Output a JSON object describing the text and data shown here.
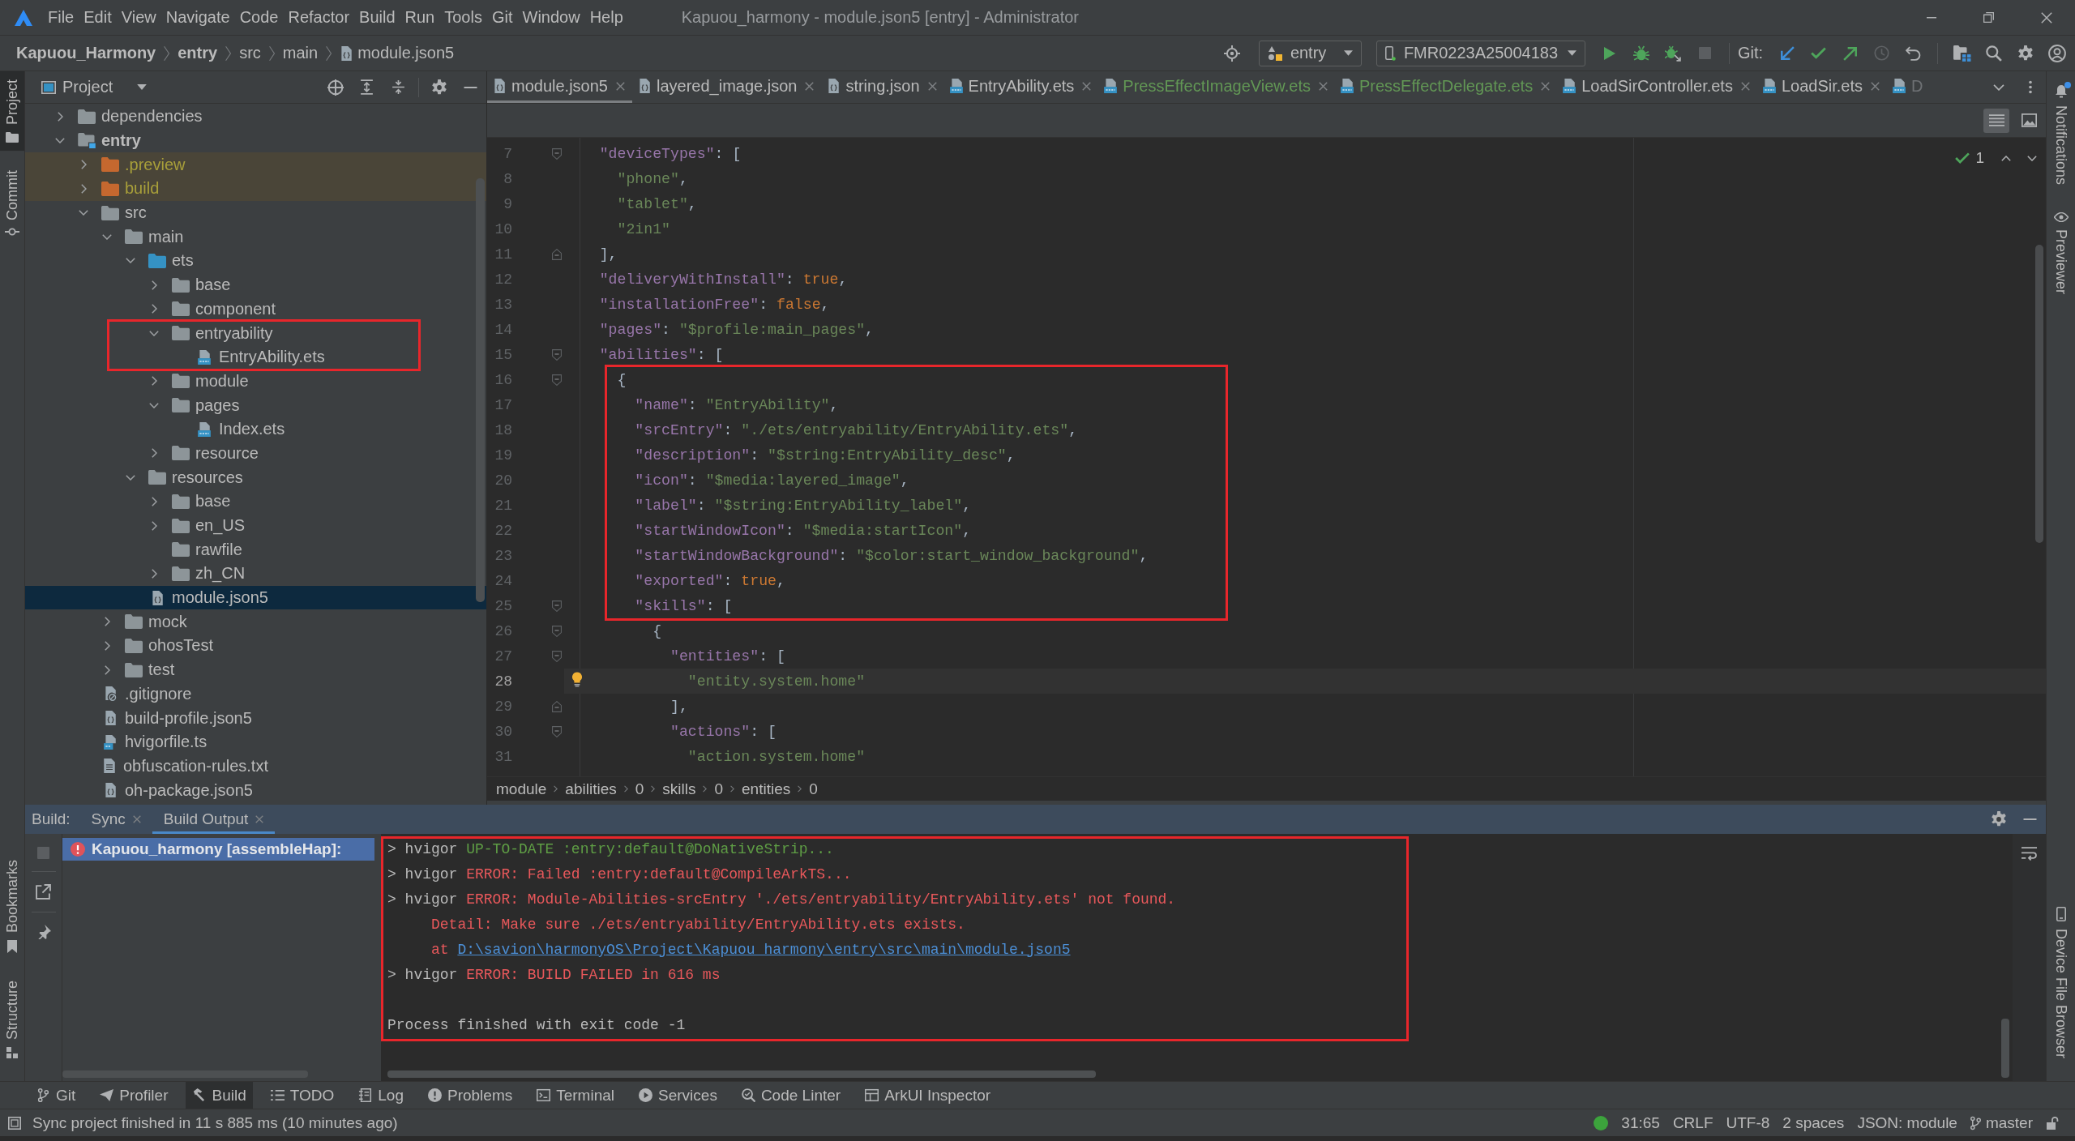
{
  "title_bar": {
    "menu": [
      "File",
      "Edit",
      "View",
      "Navigate",
      "Code",
      "Refactor",
      "Build",
      "Run",
      "Tools",
      "Git",
      "Window",
      "Help"
    ],
    "title": "Kapuou_harmony - module.json5 [entry] - Administrator"
  },
  "navigation_bar": {
    "breadcrumbs": [
      {
        "label": "Kapuou_Harmony",
        "kind": "project"
      },
      {
        "label": "entry",
        "kind": "module"
      },
      {
        "label": "src",
        "kind": "folder"
      },
      {
        "label": "main",
        "kind": "folder"
      },
      {
        "label": "module.json5",
        "kind": "json_file"
      }
    ],
    "run_configuration": "entry",
    "device": "FMR0223A25004183",
    "git_label": "Git:"
  },
  "left_strip": {
    "top": [
      {
        "label": "Project",
        "selected": true
      },
      {
        "label": "Commit",
        "selected": false
      }
    ],
    "bottom": [
      {
        "label": "Bookmarks",
        "selected": false
      },
      {
        "label": "Structure",
        "selected": false
      }
    ]
  },
  "right_strip": {
    "top": [
      {
        "label": "Notifications",
        "selected": false,
        "unread": true
      },
      {
        "label": "Previewer",
        "selected": false,
        "unread": false
      }
    ],
    "bottom": [
      {
        "label": "Device File Browser",
        "selected": false,
        "unread": false
      }
    ]
  },
  "project_panel": {
    "title": "Project",
    "tree": [
      {
        "label": "dependencies",
        "kind": "folder",
        "expanded": false,
        "selected": false
      },
      {
        "label": "entry",
        "kind": "module",
        "expanded": true,
        "selected": false,
        "children": [
          {
            "label": ".preview",
            "kind": "excluded_folder",
            "expanded": false,
            "selected": false
          },
          {
            "label": "build",
            "kind": "excluded_folder",
            "expanded": false,
            "selected": false
          },
          {
            "label": "src",
            "kind": "folder",
            "expanded": true,
            "selected": false,
            "children": [
              {
                "label": "main",
                "kind": "folder",
                "expanded": true,
                "selected": false,
                "children": [
                  {
                    "label": "ets",
                    "kind": "source_folder",
                    "expanded": true,
                    "selected": false,
                    "children": [
                      {
                        "label": "base",
                        "kind": "folder",
                        "expanded": false,
                        "selected": false
                      },
                      {
                        "label": "component",
                        "kind": "folder",
                        "expanded": false,
                        "selected": false
                      },
                      {
                        "label": "entryability",
                        "kind": "folder",
                        "expanded": true,
                        "selected": false,
                        "boxed": true,
                        "children": [
                          {
                            "label": "EntryAbility.ets",
                            "kind": "ets_file",
                            "selected": false
                          }
                        ]
                      },
                      {
                        "label": "module",
                        "kind": "folder",
                        "expanded": false,
                        "selected": false
                      },
                      {
                        "label": "pages",
                        "kind": "folder",
                        "expanded": true,
                        "selected": false,
                        "children": [
                          {
                            "label": "Index.ets",
                            "kind": "ets_file",
                            "selected": false
                          }
                        ]
                      },
                      {
                        "label": "resource",
                        "kind": "folder",
                        "expanded": false,
                        "selected": false
                      }
                    ]
                  },
                  {
                    "label": "resources",
                    "kind": "folder",
                    "expanded": true,
                    "selected": false,
                    "children": [
                      {
                        "label": "base",
                        "kind": "folder",
                        "expanded": false,
                        "selected": false
                      },
                      {
                        "label": "en_US",
                        "kind": "folder",
                        "expanded": false,
                        "selected": false
                      },
                      {
                        "label": "rawfile",
                        "kind": "folder",
                        "selected": false
                      },
                      {
                        "label": "zh_CN",
                        "kind": "folder",
                        "expanded": false,
                        "selected": false
                      }
                    ]
                  },
                  {
                    "label": "module.json5",
                    "kind": "json_file",
                    "selected": true
                  }
                ]
              },
              {
                "label": "mock",
                "kind": "folder",
                "expanded": false,
                "selected": false
              },
              {
                "label": "ohosTest",
                "kind": "folder",
                "expanded": false,
                "selected": false
              },
              {
                "label": "test",
                "kind": "folder",
                "expanded": false,
                "selected": false
              }
            ]
          },
          {
            "label": ".gitignore",
            "kind": "ignore_file",
            "selected": false
          },
          {
            "label": "build-profile.json5",
            "kind": "json_file",
            "selected": false
          },
          {
            "label": "hvigorfile.ts",
            "kind": "ts_file",
            "selected": false
          },
          {
            "label": "obfuscation-rules.txt",
            "kind": "text_file",
            "selected": false
          },
          {
            "label": "oh-package.json5",
            "kind": "json_file",
            "selected": false
          }
        ]
      }
    ]
  },
  "editor": {
    "tabs": [
      {
        "label": "module.json5",
        "kind": "json",
        "selected": true,
        "vcs_added": false
      },
      {
        "label": "layered_image.json",
        "kind": "json",
        "selected": false,
        "vcs_added": false
      },
      {
        "label": "string.json",
        "kind": "json",
        "selected": false,
        "vcs_added": false
      },
      {
        "label": "EntryAbility.ets",
        "kind": "ets",
        "selected": false,
        "vcs_added": false
      },
      {
        "label": "PressEffectImageView.ets",
        "kind": "ets",
        "selected": false,
        "vcs_added": true
      },
      {
        "label": "PressEffectDelegate.ets",
        "kind": "ets",
        "selected": false,
        "vcs_added": true
      },
      {
        "label": "LoadSirController.ets",
        "kind": "ets",
        "selected": false,
        "vcs_added": false
      },
      {
        "label": "LoadSir.ets",
        "kind": "ets",
        "selected": false,
        "vcs_added": false
      },
      {
        "label": "D",
        "kind": "ets",
        "selected": false,
        "vcs_added": false,
        "truncated": true
      }
    ],
    "view_toggles": [
      {
        "selected": true
      },
      {
        "selected": false
      }
    ],
    "inspection_count": "1",
    "blocks": [
      {
        "boxed": false,
        "lines": [
          {
            "number": "7",
            "code": "    \"deviceTypes\": [",
            "fold_start": true,
            "fold_end": false,
            "current": false,
            "intention": false
          },
          {
            "number": "8",
            "code": "      \"phone\",",
            "fold_start": false,
            "fold_end": false,
            "current": false,
            "intention": false
          },
          {
            "number": "9",
            "code": "      \"tablet\",",
            "fold_start": false,
            "fold_end": false,
            "current": false,
            "intention": false
          },
          {
            "number": "10",
            "code": "      \"2in1\"",
            "fold_start": false,
            "fold_end": false,
            "current": false,
            "intention": false
          },
          {
            "number": "11",
            "code": "    ],",
            "fold_start": false,
            "fold_end": true,
            "current": false,
            "intention": false
          },
          {
            "number": "12",
            "code": "    \"deliveryWithInstall\": true,",
            "fold_start": false,
            "fold_end": false,
            "current": false,
            "intention": false
          },
          {
            "number": "13",
            "code": "    \"installationFree\": false,",
            "fold_start": false,
            "fold_end": false,
            "current": false,
            "intention": false
          },
          {
            "number": "14",
            "code": "    \"pages\": \"$profile:main_pages\",",
            "fold_start": false,
            "fold_end": false,
            "current": false,
            "intention": false
          },
          {
            "number": "15",
            "code": "    \"abilities\": [",
            "fold_start": true,
            "fold_end": false,
            "current": false,
            "intention": false
          }
        ]
      },
      {
        "boxed": true,
        "lines": [
          {
            "number": "16",
            "code": "      {",
            "fold_start": true,
            "fold_end": false,
            "current": false,
            "intention": false
          },
          {
            "number": "17",
            "code": "        \"name\": \"EntryAbility\",",
            "fold_start": false,
            "fold_end": false,
            "current": false,
            "intention": false
          },
          {
            "number": "18",
            "code": "        \"srcEntry\": \"./ets/entryability/EntryAbility.ets\",",
            "fold_start": false,
            "fold_end": false,
            "current": false,
            "intention": false
          },
          {
            "number": "19",
            "code": "        \"description\": \"$string:EntryAbility_desc\",",
            "fold_start": false,
            "fold_end": false,
            "current": false,
            "intention": false
          },
          {
            "number": "20",
            "code": "        \"icon\": \"$media:layered_image\",",
            "fold_start": false,
            "fold_end": false,
            "current": false,
            "intention": false
          },
          {
            "number": "21",
            "code": "        \"label\": \"$string:EntryAbility_label\",",
            "fold_start": false,
            "fold_end": false,
            "current": false,
            "intention": false
          },
          {
            "number": "22",
            "code": "        \"startWindowIcon\": \"$media:startIcon\",",
            "fold_start": false,
            "fold_end": false,
            "current": false,
            "intention": false
          },
          {
            "number": "23",
            "code": "        \"startWindowBackground\": \"$color:start_window_background\",",
            "fold_start": false,
            "fold_end": false,
            "current": false,
            "intention": false
          },
          {
            "number": "24",
            "code": "        \"exported\": true,",
            "fold_start": false,
            "fold_end": false,
            "current": false,
            "intention": false
          },
          {
            "number": "25",
            "code": "        \"skills\": [",
            "fold_start": true,
            "fold_end": false,
            "current": false,
            "intention": false
          }
        ]
      },
      {
        "boxed": false,
        "lines": [
          {
            "number": "26",
            "code": "          {",
            "fold_start": true,
            "fold_end": false,
            "current": false,
            "intention": false
          },
          {
            "number": "27",
            "code": "            \"entities\": [",
            "fold_start": true,
            "fold_end": false,
            "current": false,
            "intention": false
          },
          {
            "number": "28",
            "code": "              \"entity.system.home\"",
            "fold_start": false,
            "fold_end": false,
            "current": true,
            "intention": true
          },
          {
            "number": "29",
            "code": "            ],",
            "fold_start": false,
            "fold_end": true,
            "current": false,
            "intention": false
          },
          {
            "number": "30",
            "code": "            \"actions\": [",
            "fold_start": true,
            "fold_end": false,
            "current": false,
            "intention": false
          },
          {
            "number": "31",
            "code": "              \"action.system.home\"",
            "fold_start": false,
            "fold_end": false,
            "current": false,
            "intention": false
          }
        ]
      }
    ],
    "breadcrumbs": [
      "module",
      "abilities",
      "0",
      "skills",
      "0",
      "entities",
      "0"
    ]
  },
  "build_panel": {
    "title": "Build:",
    "tabs": [
      {
        "label": "Sync",
        "selected": false
      },
      {
        "label": "Build Output",
        "selected": true
      }
    ],
    "tree": [
      {
        "label": "Kapuou_harmony [assembleHap]:",
        "error": true,
        "selected": true
      }
    ],
    "console": {
      "boxed": true,
      "lines": [
        {
          "segments": [
            {
              "kind": "prompt",
              "text": "> hvigor "
            },
            {
              "kind": "success",
              "text": "UP-TO-DATE :entry:default@DoNativeStrip..."
            }
          ]
        },
        {
          "segments": [
            {
              "kind": "prompt",
              "text": "> hvigor "
            },
            {
              "kind": "error",
              "text": "ERROR: Failed :entry:default@CompileArkTS..."
            }
          ]
        },
        {
          "segments": [
            {
              "kind": "prompt",
              "text": "> hvigor "
            },
            {
              "kind": "error",
              "text": "ERROR: Module-Abilities-srcEntry './ets/entryability/EntryAbility.ets' not found."
            }
          ]
        },
        {
          "segments": [
            {
              "kind": "error",
              "text": "     Detail: Make sure ./ets/entryability/EntryAbility.ets exists."
            }
          ]
        },
        {
          "segments": [
            {
              "kind": "error",
              "text": "     at "
            },
            {
              "kind": "link",
              "text": "D:\\savion\\harmonyOS\\Project\\Kapuou_harmony\\entry\\src\\main\\module.json5"
            }
          ]
        },
        {
          "segments": [
            {
              "kind": "prompt",
              "text": "> hvigor "
            },
            {
              "kind": "error",
              "text": "ERROR: BUILD FAILED in 616 ms"
            }
          ]
        },
        {
          "segments": [
            {
              "kind": "plain",
              "text": "Process finished with exit code -1"
            }
          ],
          "spaced": true
        }
      ]
    }
  },
  "tool_window_bar": [
    {
      "label": "Git",
      "selected": false
    },
    {
      "label": "Profiler",
      "selected": false
    },
    {
      "label": "Build",
      "selected": true
    },
    {
      "label": "TODO",
      "selected": false
    },
    {
      "label": "Log",
      "selected": false
    },
    {
      "label": "Problems",
      "selected": false
    },
    {
      "label": "Terminal",
      "selected": false
    },
    {
      "label": "Services",
      "selected": false
    },
    {
      "label": "Code Linter",
      "selected": false
    },
    {
      "label": "ArkUI Inspector",
      "selected": false
    }
  ],
  "status_bar": {
    "message": "Sync project finished in 11 s 885 ms (10 minutes ago)",
    "position": "31:65",
    "line_separator": "CRLF",
    "encoding": "UTF-8",
    "indent": "2 spaces",
    "file_type": "JSON: module",
    "branch": "master"
  }
}
